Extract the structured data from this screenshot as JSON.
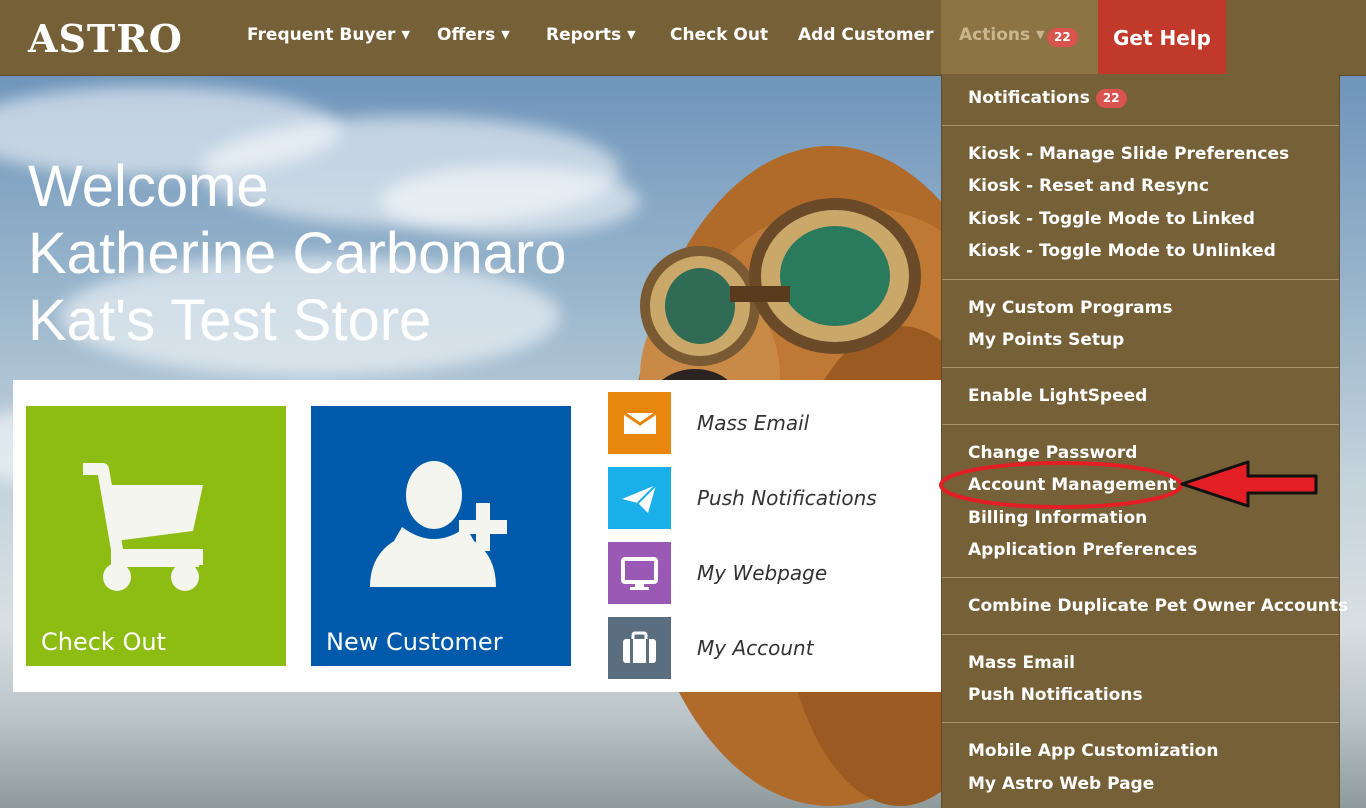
{
  "nav": {
    "logo": "ASTRO",
    "items": [
      {
        "label": "Frequent Buyer",
        "has_caret": true
      },
      {
        "label": "Offers",
        "has_caret": true
      },
      {
        "label": "Reports",
        "has_caret": true
      },
      {
        "label": "Check Out",
        "has_caret": false
      },
      {
        "label": "Add Customer",
        "has_caret": false
      }
    ],
    "actions_label": "Actions",
    "actions_badge": "22",
    "help_label": "Get Help",
    "colors": {
      "bar": "#766038",
      "actions_active": "#8c7445",
      "help": "#c0392b",
      "badge": "#d9534f"
    }
  },
  "welcome": {
    "line1": "Welcome",
    "line2": "Katherine Carbonaro",
    "line3": "Kat's Test Store"
  },
  "tiles": {
    "checkout": {
      "label": "Check Out",
      "icon": "shopping-cart-icon",
      "color": "#8dbc13"
    },
    "new_customer": {
      "label": "New Customer",
      "icon": "add-user-icon",
      "color": "#005aab"
    }
  },
  "quick_links": [
    {
      "label": "Mass Email",
      "icon": "envelope-icon",
      "color": "#e8870e"
    },
    {
      "label": "Push Notifications",
      "icon": "paper-plane-icon",
      "color": "#19b0ea"
    },
    {
      "label": "My Webpage",
      "icon": "monitor-icon",
      "color": "#9b59b6"
    },
    {
      "label": "My Account",
      "icon": "briefcase-icon",
      "color": "#5b6e80"
    }
  ],
  "dropdown": {
    "notifications_label": "Notifications",
    "notifications_badge": "22",
    "groups": [
      [
        "Kiosk - Manage Slide Preferences",
        "Kiosk - Reset and Resync",
        "Kiosk - Toggle Mode to Linked",
        "Kiosk - Toggle Mode to Unlinked"
      ],
      [
        "My Custom Programs",
        "My Points Setup"
      ],
      [
        "Enable LightSpeed"
      ],
      [
        "Change Password",
        "Account Management",
        "Billing Information",
        "Application Preferences"
      ],
      [
        "Combine Duplicate Pet Owner Accounts"
      ],
      [
        "Mass Email",
        "Push Notifications"
      ],
      [
        "Mobile App Customization",
        "My Astro Web Page"
      ]
    ]
  },
  "annotation": {
    "highlighted_item": "Account Management",
    "color": "#e31e24"
  }
}
